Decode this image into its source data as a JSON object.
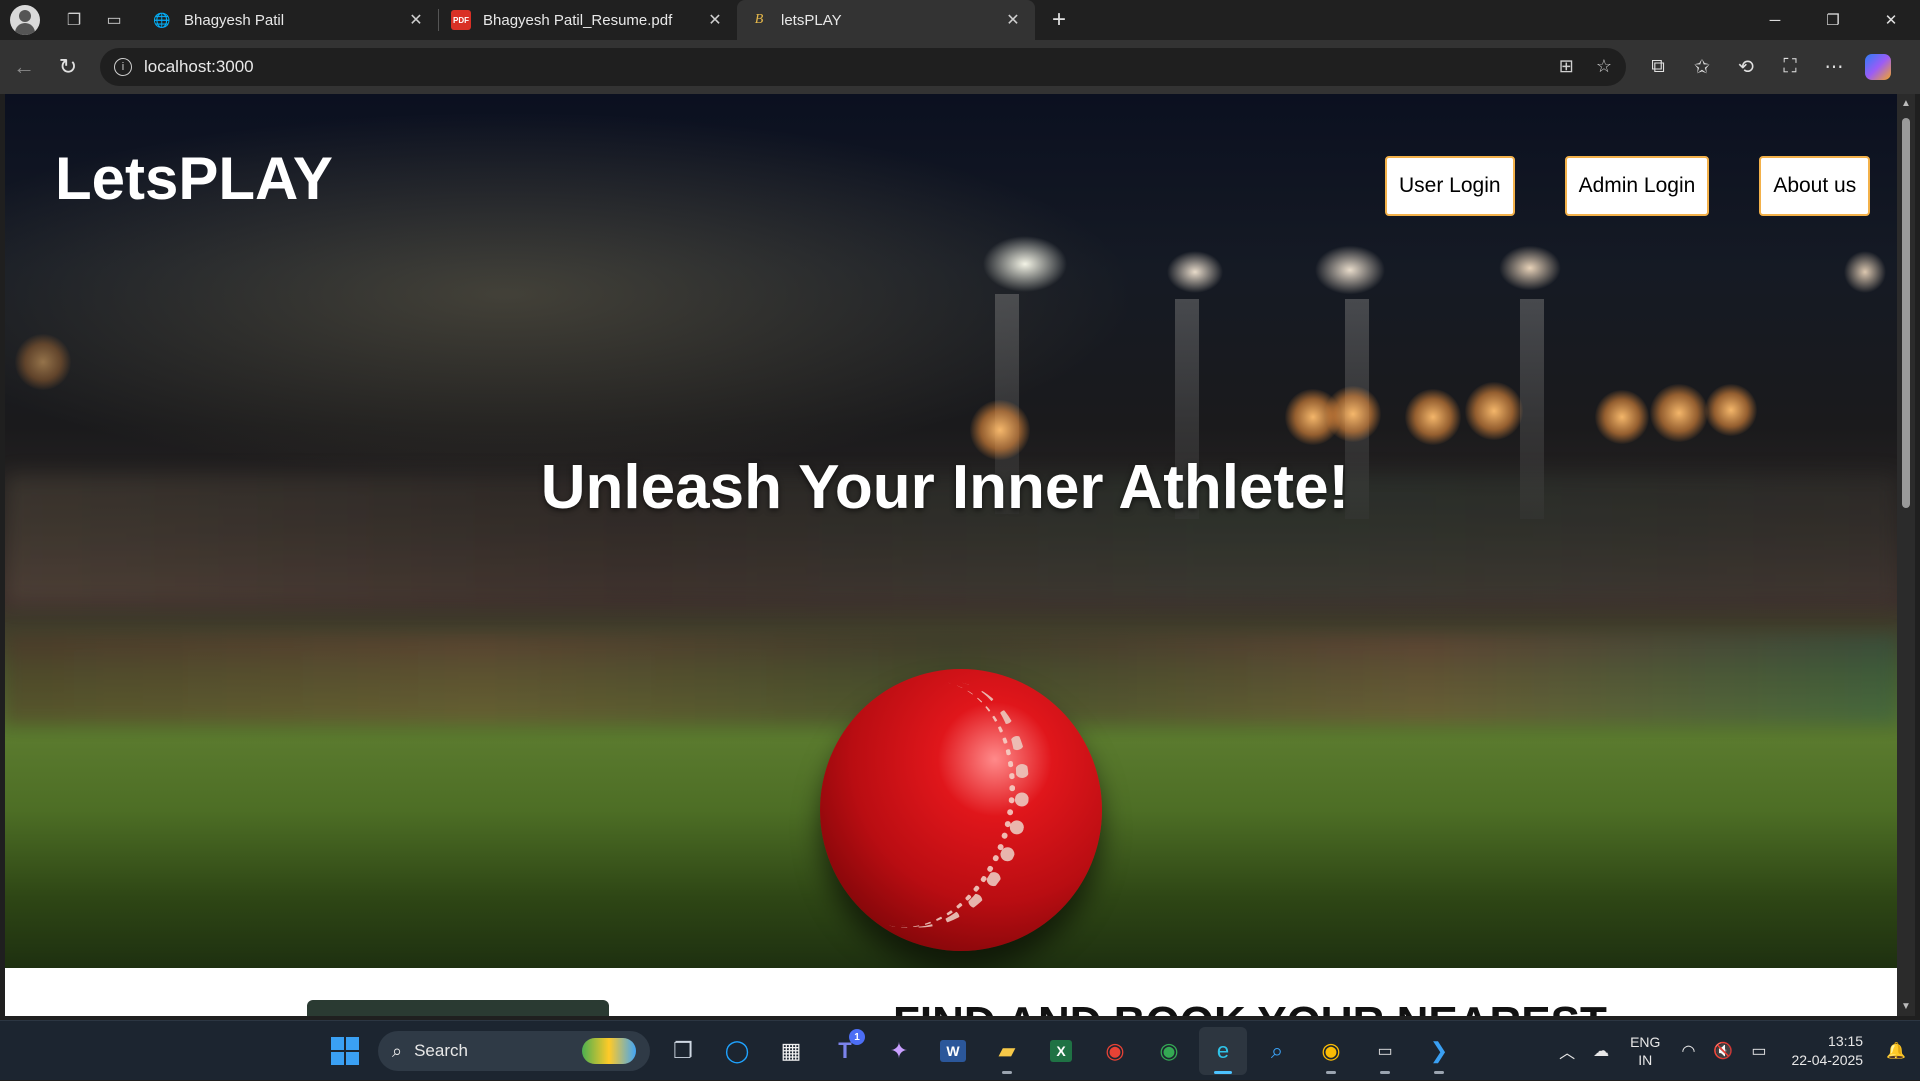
{
  "browser": {
    "tabs": [
      {
        "title": "Bhagyesh Patil",
        "favicon": "globe-icon",
        "active": false
      },
      {
        "title": "Bhagyesh Patil_Resume.pdf",
        "favicon": "pdf-icon",
        "active": false
      },
      {
        "title": "letsPLAY",
        "favicon": "brand-b-icon",
        "active": true
      }
    ],
    "address": "localhost:3000"
  },
  "page": {
    "brand": "LetsPLAY",
    "nav": [
      "User Login",
      "Admin Login",
      "About us"
    ],
    "hero_title": "Unleash Your Inner Athlete!",
    "next_section_title": "FIND AND BOOK YOUR NEAREST",
    "accent_color": "#f3b14a"
  },
  "taskbar": {
    "search_placeholder": "Search",
    "teams_badge": "1",
    "language": {
      "line1": "ENG",
      "line2": "IN"
    },
    "time": "13:15",
    "date": "22-04-2025"
  }
}
